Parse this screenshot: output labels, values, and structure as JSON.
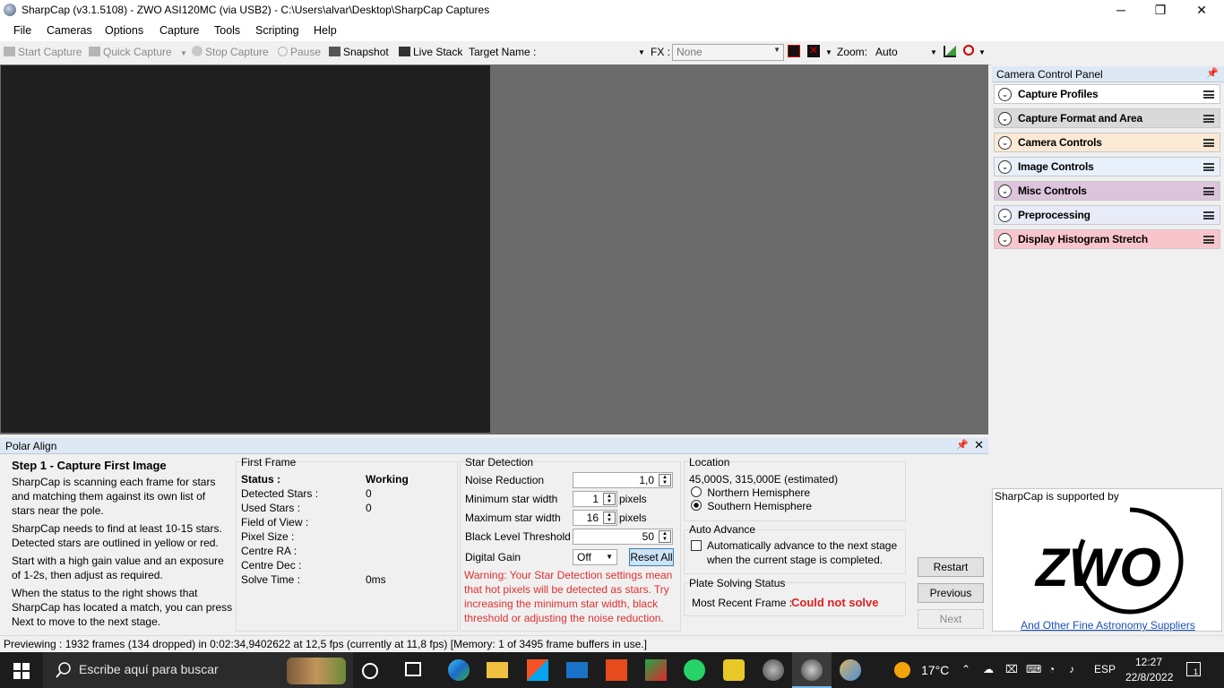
{
  "window": {
    "title": "SharpCap (v3.1.5108) - ZWO ASI120MC (via USB2) - C:\\Users\\alvar\\Desktop\\SharpCap Captures",
    "minimize": "─",
    "maximize": "❐",
    "close": "✕"
  },
  "menu": [
    "File",
    "Cameras",
    "Options",
    "Capture",
    "Tools",
    "Scripting",
    "Help"
  ],
  "toolbar": {
    "start_capture": "Start Capture",
    "quick_capture": "Quick Capture",
    "stop_capture": "Stop Capture",
    "pause": "Pause",
    "snapshot": "Snapshot",
    "live_stack": "Live Stack",
    "target_name_label": "Target Name :",
    "target_name_value": "",
    "fx_label": "FX :",
    "fx_value": "None",
    "zoom_label": "Zoom:",
    "zoom_value": "Auto"
  },
  "camera_panel": {
    "title": "Camera Control Panel",
    "sections": [
      {
        "label": "Capture Profiles",
        "color": "#ffffff"
      },
      {
        "label": "Capture Format and Area",
        "color": "#d9d9d9"
      },
      {
        "label": "Camera Controls",
        "color": "#fbe9d5"
      },
      {
        "label": "Image Controls",
        "color": "#e8f1fb"
      },
      {
        "label": "Misc Controls",
        "color": "#dcc4dd"
      },
      {
        "label": "Preprocessing",
        "color": "#e8ecf8"
      },
      {
        "label": "Display Histogram Stretch",
        "color": "#f9c5cc"
      }
    ],
    "sponsor_text": "SharpCap is supported by",
    "sponsor_logo": "ZWO",
    "sponsor_link": "And Other Fine Astronomy Suppliers"
  },
  "polar_align": {
    "title": "Polar Align",
    "step_title": "Step 1 - Capture First Image",
    "instructions": [
      [
        "SharpCap is scanning each frame for stars",
        "and matching them against its own list of",
        "stars near the pole."
      ],
      [
        "SharpCap needs to find at least 10-15 stars.",
        "Detected stars are outlined in yellow or red."
      ],
      [
        "Start with a high gain value and an exposure",
        "of 1-2s, then adjust as required."
      ],
      [
        "When the status to the right shows that",
        "SharpCap has located a match, you can press",
        "Next to move to the next stage."
      ]
    ],
    "first_frame": {
      "title": "First Frame",
      "rows": [
        {
          "label": "Status :",
          "value": "Working"
        },
        {
          "label": "Detected Stars :",
          "value": "0"
        },
        {
          "label": "Used Stars :",
          "value": "0"
        },
        {
          "label": "Field of View :",
          "value": ""
        },
        {
          "label": "Pixel Size :",
          "value": ""
        },
        {
          "label": "Centre RA :",
          "value": ""
        },
        {
          "label": "Centre Dec :",
          "value": ""
        },
        {
          "label": "Solve Time :",
          "value": "0ms"
        }
      ]
    },
    "star_detection": {
      "title": "Star Detection",
      "noise_reduction_label": "Noise Reduction",
      "noise_reduction_value": "1,0",
      "min_width_label": "Minimum star width",
      "min_width_value": "1",
      "max_width_label": "Maximum star width",
      "max_width_value": "16",
      "pixels_unit": "pixels",
      "black_level_label": "Black Level Threshold",
      "black_level_value": "50",
      "digital_gain_label": "Digital Gain",
      "digital_gain_value": "Off",
      "reset_all": "Reset All",
      "warning": [
        "Warning: Your Star Detection settings mean",
        "that hot pixels will be detected as stars. Try",
        "increasing the minimum star width, black",
        "threshold or adjusting the noise reduction."
      ],
      "warning_color": "#e03030"
    },
    "location": {
      "title": "Location",
      "coords": "45,000S, 315,000E (estimated)",
      "northern": "Northern Hemisphere",
      "southern": "Southern Hemisphere",
      "selected": "Southern Hemisphere"
    },
    "auto_advance": {
      "title": "Auto Advance",
      "line1": "Automatically advance to the next stage",
      "line2": "when the current stage is completed.",
      "checked": false
    },
    "plate_solving": {
      "title": "Plate Solving Status",
      "label": "Most Recent Frame :",
      "value": "Could not solve"
    },
    "buttons": {
      "restart": "Restart",
      "previous": "Previous",
      "next": "Next"
    }
  },
  "status_bar": "Previewing : 1932 frames (134 dropped) in 0:02:34,9402622 at 12,5 fps  (currently at 11,8 fps) [Memory: 1 of 3495 frame buffers in use.]",
  "taskbar": {
    "search_placeholder": "Escribe aquí para buscar",
    "temperature": "17°C",
    "language": "ESP",
    "time": "12:27",
    "date": "22/8/2022",
    "notification_count": "1"
  }
}
